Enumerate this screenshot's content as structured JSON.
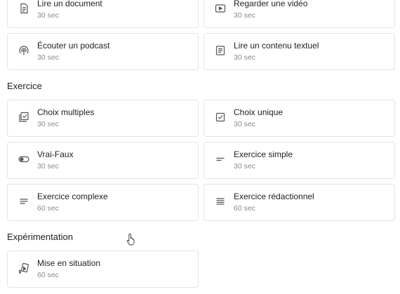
{
  "sections": [
    {
      "title": ""
    },
    {
      "title": "Exercice"
    },
    {
      "title": "Expérimentation"
    }
  ],
  "cards": [
    {
      "title": "Lire un document",
      "duration": "30 sec",
      "icon": "document-icon"
    },
    {
      "title": "Regarder une vidéo",
      "duration": "30 sec",
      "icon": "play-video-icon"
    },
    {
      "title": "Écouter un podcast",
      "duration": "30 sec",
      "icon": "podcast-icon"
    },
    {
      "title": "Lire un contenu textuel",
      "duration": "30 sec",
      "icon": "text-content-icon"
    },
    {
      "title": "Choix multiples",
      "duration": "30 sec",
      "icon": "multiple-choice-icon"
    },
    {
      "title": "Choix unique",
      "duration": "30 sec",
      "icon": "single-choice-icon"
    },
    {
      "title": "Vrai-Faux",
      "duration": "30 sec",
      "icon": "toggle-icon"
    },
    {
      "title": "Exercice simple",
      "duration": "30 sec",
      "icon": "simple-lines-icon"
    },
    {
      "title": "Exercice complexe",
      "duration": "60 sec",
      "icon": "complex-lines-icon"
    },
    {
      "title": "Exercice rédactionnel",
      "duration": "60 sec",
      "icon": "essay-lines-icon"
    },
    {
      "title": "Mise en situation",
      "duration": "60 sec",
      "icon": "scenario-icon"
    }
  ],
  "colors": {
    "border": "#e4e4e4",
    "muted": "#8a8a8a",
    "icon": "#555555"
  }
}
